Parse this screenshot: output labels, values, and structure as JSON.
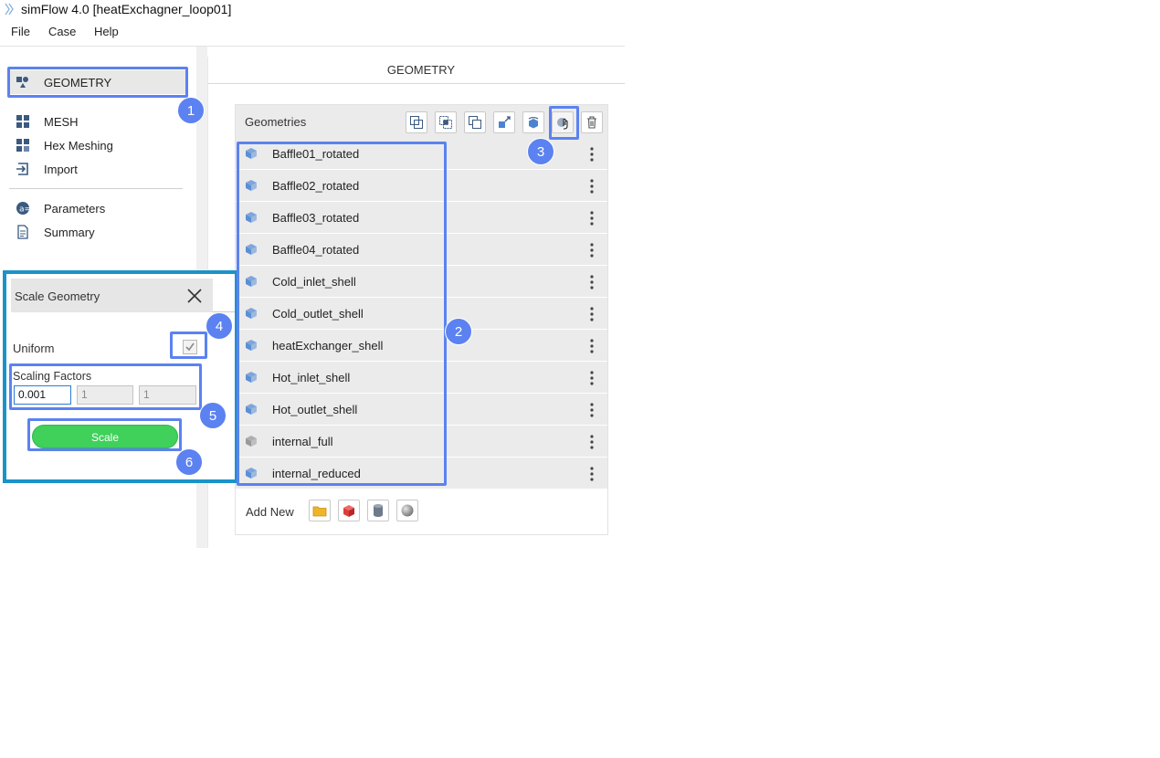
{
  "window": {
    "title": "simFlow 4.0 [heatExchagner_loop01]"
  },
  "menu": [
    "File",
    "Case",
    "Help"
  ],
  "sidebar": {
    "items": [
      {
        "label": "GEOMETRY",
        "icon": "geometry-icon"
      },
      {
        "label": "MESH",
        "icon": "mesh-icon"
      },
      {
        "label": "Hex Meshing",
        "icon": "hex-meshing-icon"
      },
      {
        "label": "Import",
        "icon": "import-icon"
      },
      {
        "label": "Parameters",
        "icon": "parameters-icon"
      },
      {
        "label": "Summary",
        "icon": "summary-icon"
      }
    ]
  },
  "main": {
    "title": "GEOMETRY",
    "panel_label": "Geometries",
    "toolbar_icons": [
      "boolean-union-icon",
      "boolean-intersect-icon",
      "boolean-subtract-icon",
      "transform-icon",
      "rotate-icon",
      "scale-icon",
      "delete-icon"
    ],
    "geometries": [
      {
        "name": "Baffle01_rotated",
        "color": "#5b8fd6"
      },
      {
        "name": "Baffle02_rotated",
        "color": "#5b8fd6"
      },
      {
        "name": "Baffle03_rotated",
        "color": "#5b8fd6"
      },
      {
        "name": "Baffle04_rotated",
        "color": "#5b8fd6"
      },
      {
        "name": "Cold_inlet_shell",
        "color": "#5b8fd6"
      },
      {
        "name": "Cold_outlet_shell",
        "color": "#5b8fd6"
      },
      {
        "name": "heatExchanger_shell",
        "color": "#5b8fd6"
      },
      {
        "name": "Hot_inlet_shell",
        "color": "#5b8fd6"
      },
      {
        "name": "Hot_outlet_shell",
        "color": "#5b8fd6"
      },
      {
        "name": "internal_full",
        "color": "#9a9a9a"
      },
      {
        "name": "internal_reduced",
        "color": "#5b8fd6"
      }
    ],
    "add_new_label": "Add New",
    "add_new_icons": [
      "folder-icon",
      "box-icon",
      "cylinder-icon",
      "sphere-icon"
    ]
  },
  "dialog": {
    "title": "Scale Geometry",
    "uniform_label": "Uniform",
    "uniform_checked": true,
    "scaling_factors_label": "Scaling Factors",
    "factors": [
      "0.001",
      "1",
      "1"
    ],
    "scale_button": "Scale"
  },
  "annotations": [
    "1",
    "2",
    "3",
    "4",
    "5",
    "6"
  ],
  "colors": {
    "callout": "#5b82f0",
    "dialog_frame": "#1a93c9",
    "scale_button": "#3fd15a"
  }
}
